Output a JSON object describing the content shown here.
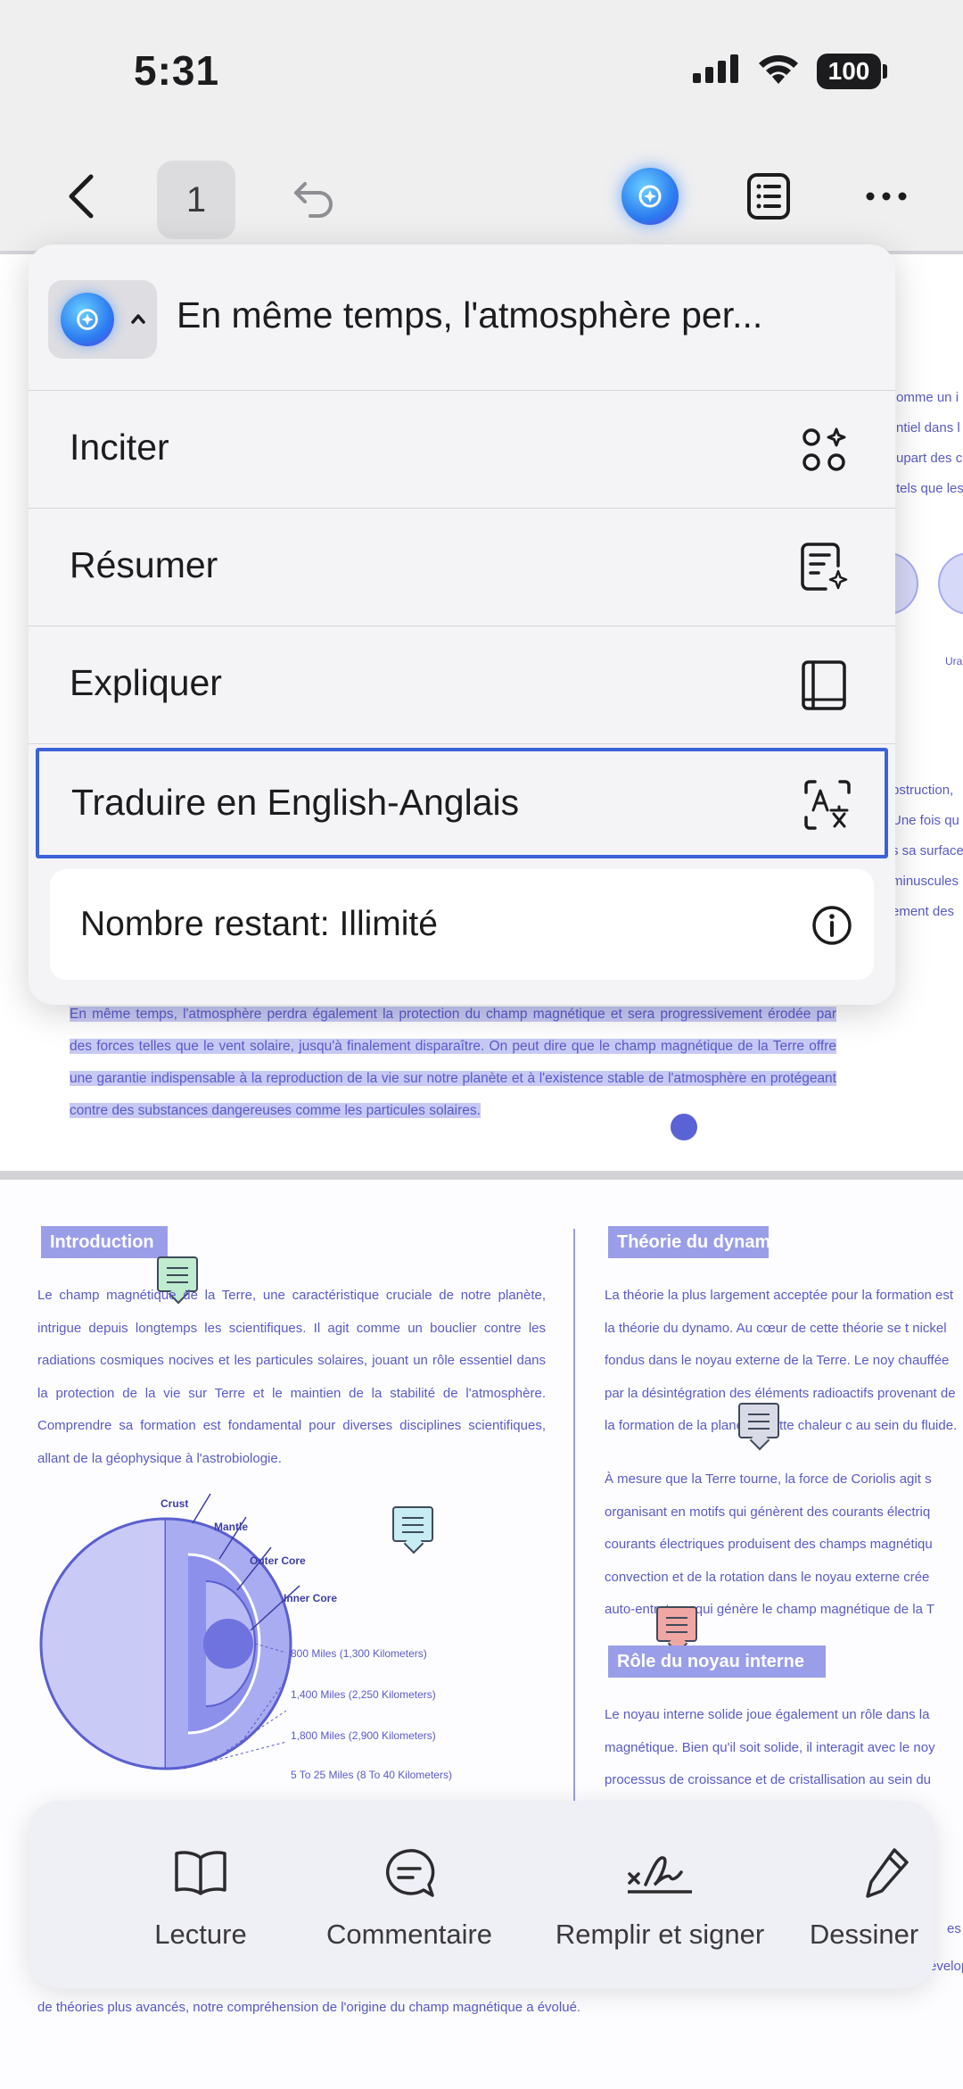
{
  "status_bar": {
    "time": "5:31",
    "battery": "100"
  },
  "toolbar": {
    "page_number": "1"
  },
  "popup": {
    "title": "En même temps, l'atmosphère per...",
    "items": [
      {
        "label": "Inciter",
        "icon": "prompt-icon"
      },
      {
        "label": "Résumer",
        "icon": "summarize-icon"
      },
      {
        "label": "Expliquer",
        "icon": "book-icon"
      },
      {
        "label": "Traduire en English-Anglais",
        "icon": "translate-icon"
      }
    ],
    "remaining": "Nombre restant: Illimité"
  },
  "doc_page1": {
    "right_fragments": [
      "omme un i",
      "ntiel dans l",
      "upart des c",
      "tels que les"
    ],
    "right_fragments2": [
      "bstruction,",
      "Une fois qu",
      "s sa surface",
      "minuscules",
      "ement des"
    ],
    "planet_label": "Ura",
    "selected_text": "En même temps, l'atmosphère perdra également la protection du champ magnétique et sera progressivement érodée par des forces telles que le vent solaire, jusqu'à finalement disparaître. On peut dire que le champ magnétique de la Terre offre une garantie indispensable à la reproduction de la vie sur notre planète et à l'existence stable de l'atmosphère en protégeant contre des substances dangereuses comme les particules solaires."
  },
  "doc_page2": {
    "intro_heading": "Introduction",
    "intro_text": "Le champ magnétique de la Terre, une caractéristique cruciale de notre planète, intrigue depuis longtemps les scientifiques. Il agit comme un bouclier contre les radiations cosmiques nocives et les particules solaires, jouant un rôle essentiel dans la protection de la vie sur Terre et le maintien de la stabilité de l'atmosphère. Comprendre sa formation est fondamental pour diverses disciplines scientifiques, allant de la géophysique à l'astrobiologie.",
    "earth_labels": [
      "Crust",
      "Mantle",
      "Outer Core",
      "Inner Core"
    ],
    "distances": [
      "800 Miles (1,300 Kilometers)",
      "1,400 Miles (2,250 Kilometers)",
      "1,800 Miles (2,900 Kilometers)",
      "5 To 25 Miles (8 To 40 Kilometers)"
    ],
    "dynamo_heading": "Théorie du dynam",
    "dynamo_text1": "La théorie la plus largement acceptée pour la formation est la théorie du dynamo. Au cœur de cette théorie se t nickel fondus dans le noyau externe de la Terre. Le noy chauffée par la désintégration des éléments radioactifs provenant de la formation de la planète. Cette chaleur c au sein du fluide.",
    "dynamo_text2": "À mesure que la Terre tourne, la force de Coriolis agit s organisant en motifs qui génèrent des courants électriq courants électriques produisent des champs magnétiqu convection et de la rotation dans le noyau externe crée auto-entretenu qui génère le champ magnétique de la T",
    "core_heading": "Rôle du noyau interne",
    "core_text": "Le noyau interne solide joue également un rôle dans la magnétique. Bien qu'il soit solide, il interagit avec le noy processus de croissance et de cristallisation au sein du",
    "bottom_text": "de théories plus avancés, notre compréhension de l'origine du champ magnétique a évolué.",
    "right_bottom_fragments": [
      "es",
      "évelop"
    ]
  },
  "bottom_bar": {
    "items": [
      {
        "label": "Lecture",
        "icon": "book-open-icon"
      },
      {
        "label": "Commentaire",
        "icon": "comment-icon"
      },
      {
        "label": "Remplir et signer",
        "icon": "signature-icon"
      },
      {
        "label": "Dessiner",
        "icon": "pen-icon"
      }
    ]
  },
  "colors": {
    "accent": "#3b63d8",
    "doc_text": "#5a5ac8",
    "selection": "#c7c9f4"
  }
}
